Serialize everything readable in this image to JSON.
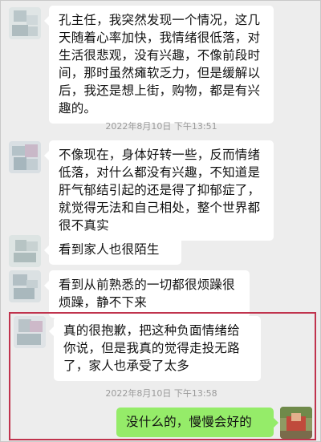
{
  "chat": {
    "messages": [
      {
        "sender": "other",
        "text": "孔主任，我突然发现一个情况，这几天随着心率加快，我情绪很低落，对生活很悲观，没有兴趣，不像前段时间，那时虽然瘫软乏力，但是缓解以后，我还是想上街，购物，都是有兴趣的。"
      },
      {
        "timestamp": "2022年8月10日 下午13:51"
      },
      {
        "sender": "other",
        "text": "不像现在，身体好转一些，反而情绪低落，对什么都没有兴趣，不知道是肝气郁结引起的还是得了抑郁症了，就觉得无法和自己相处，整个世界都很不真实"
      },
      {
        "sender": "other",
        "text": "看到家人也很陌生"
      },
      {
        "sender": "other",
        "text": "看到从前熟悉的一切都很烦躁很烦躁，静不下来"
      },
      {
        "sender": "other",
        "text": "真的很抱歉，把这种负面情绪给你说，但是我真的觉得走投无路了，家人也承受了太多"
      },
      {
        "timestamp": "2022年8月10日 下午13:58"
      },
      {
        "sender": "me",
        "text": "没什么的，慢慢会好的"
      }
    ]
  },
  "colors": {
    "background": "#ededed",
    "incoming_bubble": "#ffffff",
    "outgoing_bubble": "#95ec69",
    "highlight_border": "#c0334d",
    "timestamp_text": "#9a9a9a"
  }
}
